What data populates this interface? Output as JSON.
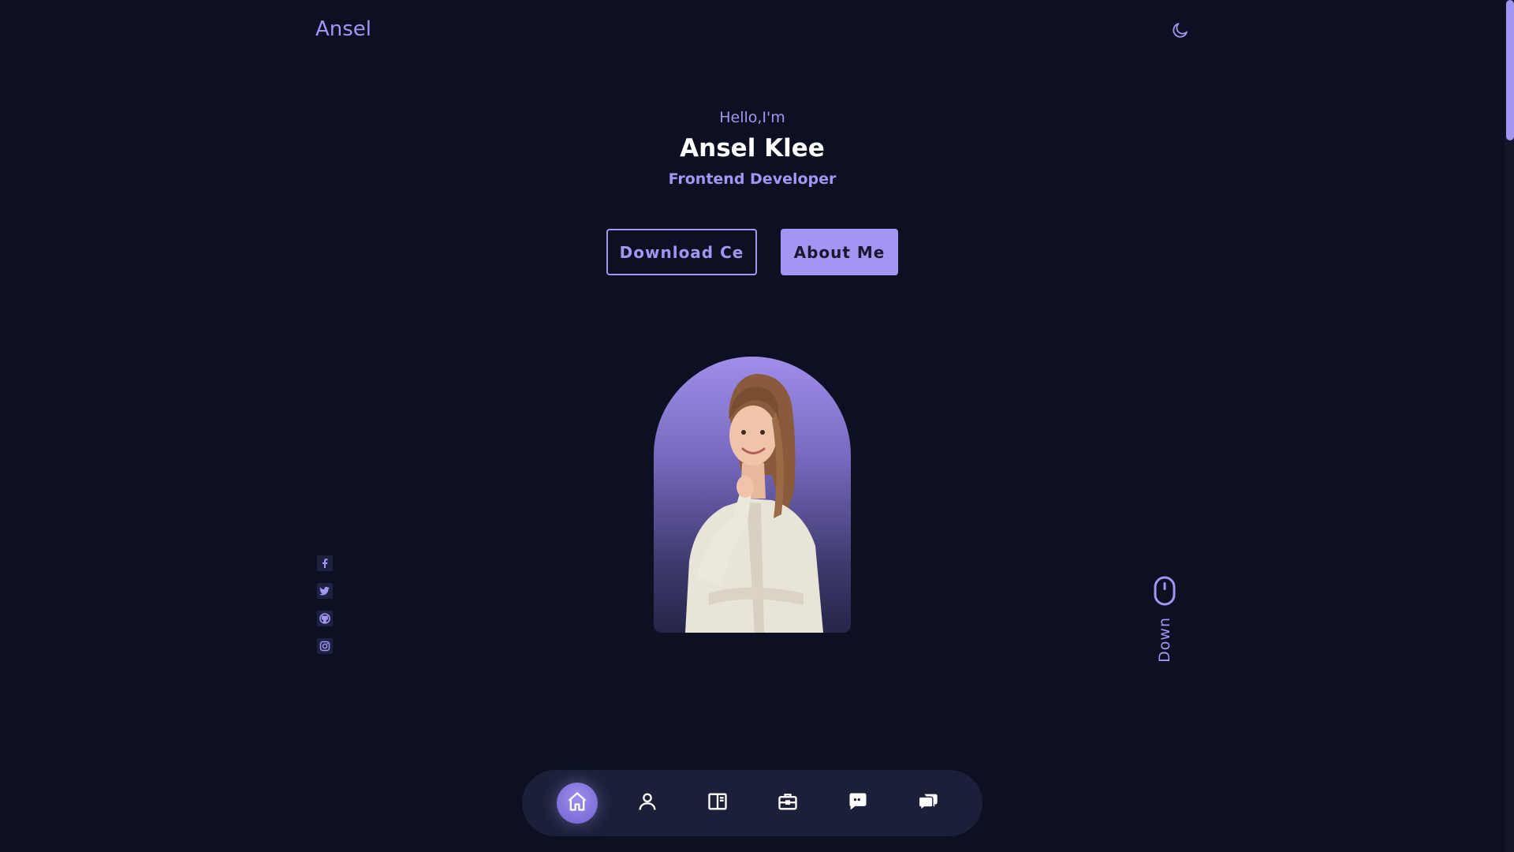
{
  "header": {
    "logo": "Ansel",
    "theme_icon": "moon-icon"
  },
  "hero": {
    "greeting": "Hello,I'm",
    "name": "Ansel Klee",
    "role": "Frontend Developer",
    "download_button": "Download Ce",
    "about_button": "About Me"
  },
  "portrait": {
    "description_icon": "profile-photo"
  },
  "socials": [
    {
      "icon": "facebook-icon"
    },
    {
      "icon": "twitter-icon"
    },
    {
      "icon": "github-icon"
    },
    {
      "icon": "instagram-icon"
    }
  ],
  "scroll": {
    "label": "Down",
    "icon": "mouse-icon"
  },
  "nav": [
    {
      "icon": "home-icon",
      "active": true
    },
    {
      "icon": "user-icon",
      "active": false
    },
    {
      "icon": "book-icon",
      "active": false
    },
    {
      "icon": "briefcase-icon",
      "active": false
    },
    {
      "icon": "message-icon",
      "active": false
    },
    {
      "icon": "chat-icon",
      "active": false
    }
  ],
  "colors": {
    "background": "#0c1022",
    "accent": "#a395f2",
    "nav_bg": "#1b1f37"
  }
}
